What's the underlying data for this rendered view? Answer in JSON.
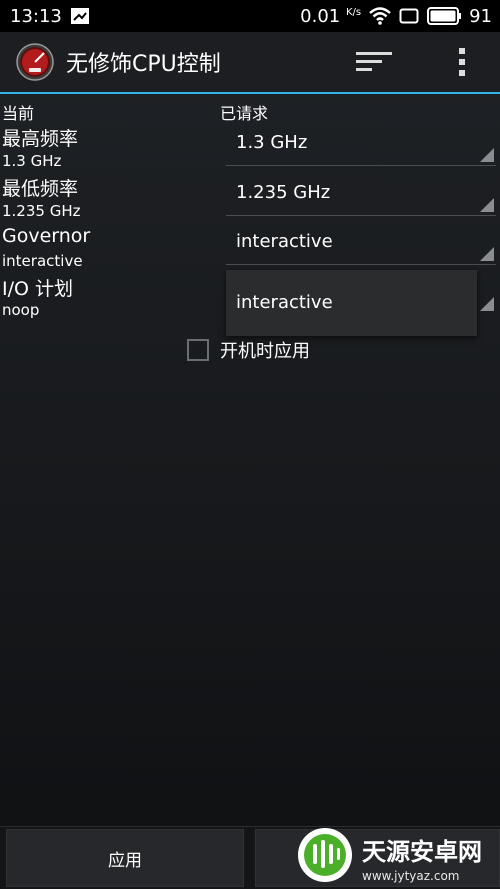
{
  "status_bar": {
    "time": "13:13",
    "network_speed": "0.01",
    "network_unit": "K/s",
    "battery": "91",
    "icons": [
      "notification-icon",
      "wifi-icon",
      "screen-icon"
    ]
  },
  "action_bar": {
    "title": "无修饰CPU控制",
    "icon": "speedometer-icon",
    "actions": [
      "sort-icon",
      "overflow-menu-icon"
    ],
    "accent": "#33b5e5"
  },
  "headers": {
    "current": "当前",
    "requested": "已请求"
  },
  "rows": [
    {
      "label": "最高频率",
      "current": "1.3 GHz",
      "requested": "1.3 GHz"
    },
    {
      "label": "最低频率",
      "current": "1.235 GHz",
      "requested": "1.235 GHz"
    },
    {
      "label": "Governor",
      "current": "interactive",
      "requested": "interactive"
    },
    {
      "label": "I/O 计划",
      "current": "noop",
      "requested": "interactive"
    }
  ],
  "boot_checkbox": {
    "label": "开机时应用",
    "checked": false
  },
  "bottom_bar": {
    "apply_label": "应用"
  },
  "watermark": {
    "title": "天源安卓网",
    "url": "www.jytyaz.com"
  }
}
